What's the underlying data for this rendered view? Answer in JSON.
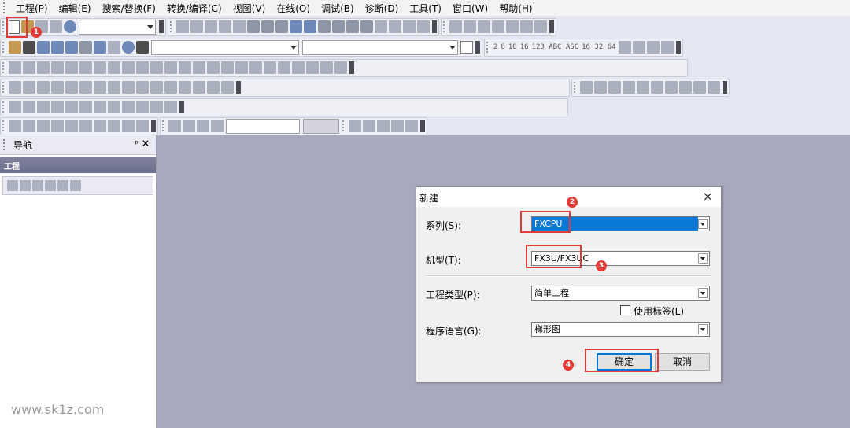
{
  "menu": {
    "items": [
      "工程(P)",
      "编辑(E)",
      "搜索/替换(F)",
      "转换/编译(C)",
      "视图(V)",
      "在线(O)",
      "调试(B)",
      "诊断(D)",
      "工具(T)",
      "窗口(W)",
      "帮助(H)"
    ]
  },
  "navigation": {
    "title": "导航",
    "pin": "ᵖ",
    "close": "×",
    "section": "工程"
  },
  "watermark": "www.sk1z.com",
  "dialog": {
    "title": "新建",
    "close": "×",
    "series_label": "系列(S):",
    "series_value": "FXCPU",
    "model_label": "机型(T):",
    "model_value": "FX3U/FX3UC",
    "project_type_label": "工程类型(P):",
    "project_type_value": "简单工程",
    "use_label_checkbox": "使用标签(L)",
    "use_label_checked": false,
    "language_label": "程序语言(G):",
    "language_value": "梯形图",
    "ok_button": "确定",
    "cancel_button": "取消"
  },
  "annotations": {
    "step1": "1",
    "step2": "2",
    "step3": "3",
    "step4": "4",
    "color": "#e03a3a"
  },
  "toolbar_text": {
    "num_icons": [
      "2",
      "8",
      "10",
      "16"
    ],
    "fmt_icons": "123 ABC ASC",
    "size_icons": "16 32 64"
  }
}
